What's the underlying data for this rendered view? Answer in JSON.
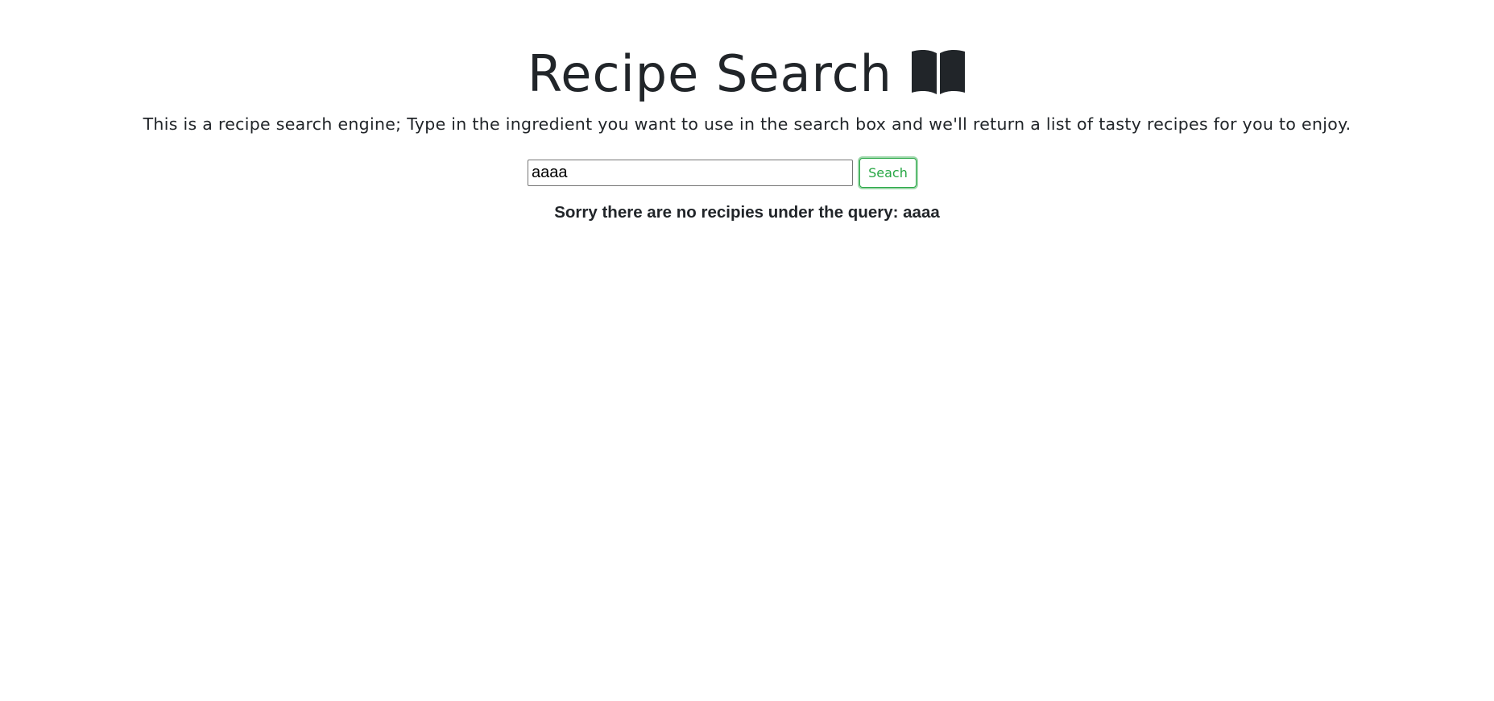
{
  "header": {
    "title": "Recipe Search",
    "icon": "open-book-icon"
  },
  "description": "This is a recipe search engine; Type in the ingredient you want to use in the search box and we'll return a list of tasty recipes for you to enjoy.",
  "search": {
    "value": "aaaa",
    "placeholder": "",
    "button_label": "Seach"
  },
  "results": {
    "message": "Sorry there are no recipies under the query: aaaa"
  },
  "colors": {
    "text": "#212529",
    "button_accent": "#28a745"
  }
}
